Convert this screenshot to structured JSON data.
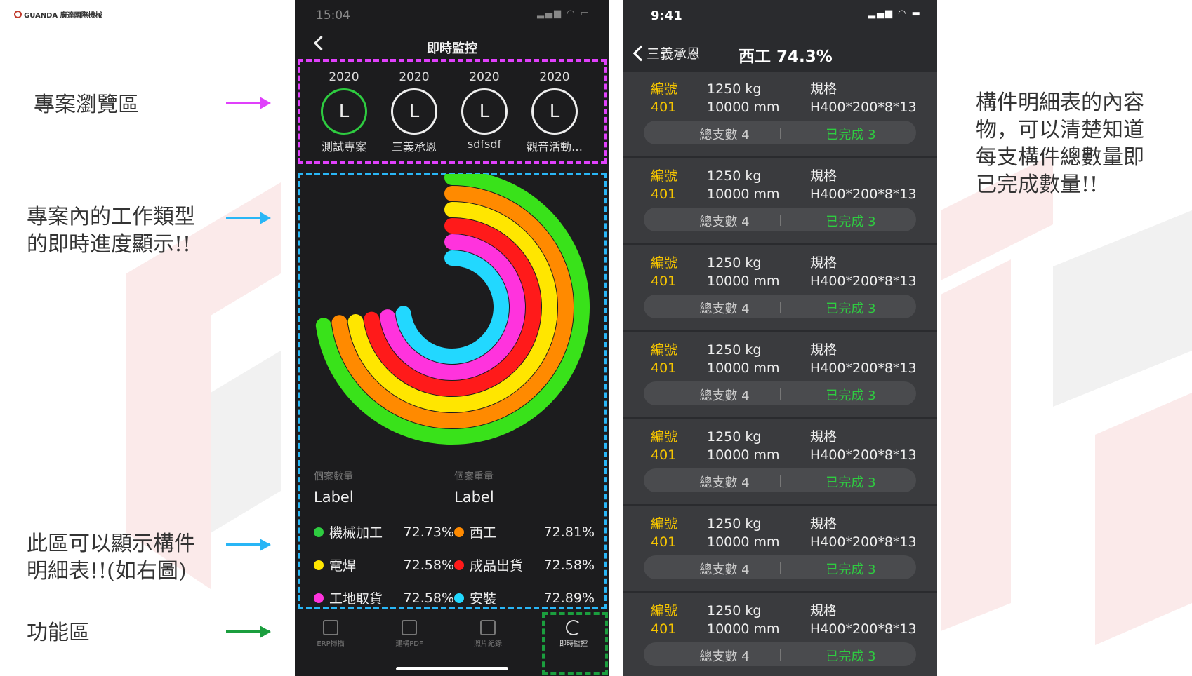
{
  "brand": {
    "logo_text": "GUANDA 廣達國際機械"
  },
  "annotations": [
    {
      "text": "專案瀏覽區",
      "color": "#e040fb"
    },
    {
      "text": "專案內的工作類型\n的即時進度顯示!!",
      "color": "#29b6f6"
    },
    {
      "text": "此區可以顯示構件\n明細表!!(如右圖)",
      "color": "#29b6f6"
    },
    {
      "text": "功能區",
      "color": "#1b9e3e"
    }
  ],
  "right_note": "構件明細表的內容\n物，可以清楚知道\n每支構件總數量即\n已完成數量!!",
  "phone1": {
    "status_time": "15:04",
    "title": "即時監控",
    "projects": [
      {
        "year": "2020",
        "letter": "L",
        "name": "測試專案",
        "ring": "#2ecc40"
      },
      {
        "year": "2020",
        "letter": "L",
        "name": "三義承恩",
        "ring": "#eeeeee"
      },
      {
        "year": "2020",
        "letter": "L",
        "name": "sdfsdf",
        "ring": "#eeeeee"
      },
      {
        "year": "2020",
        "letter": "L",
        "name": "觀音活動…",
        "ring": "#eeeeee"
      }
    ],
    "chart_data": {
      "type": "radial-bar",
      "series": [
        {
          "name": "機械加工",
          "value": 72.73,
          "color": "#39e21a"
        },
        {
          "name": "西工",
          "value": 72.81,
          "color": "#ff8a00"
        },
        {
          "name": "電焊",
          "value": 72.58,
          "color": "#ffe600"
        },
        {
          "name": "成品出貨",
          "value": 72.58,
          "color": "#ff1a1a"
        },
        {
          "name": "工地取貨",
          "value": 72.58,
          "color": "#ff33dd"
        },
        {
          "name": "安裝",
          "value": 72.89,
          "color": "#22d8ff"
        }
      ]
    },
    "stats": {
      "count_label": "個案數量",
      "count_value": "Label",
      "weight_label": "個案重量",
      "weight_value": "Label"
    },
    "legend": [
      {
        "name": "機械加工",
        "pct": "72.73%",
        "color": "#2ecc40"
      },
      {
        "name": "西工",
        "pct": "72.81%",
        "color": "#ff8a00"
      },
      {
        "name": "電焊",
        "pct": "72.58%",
        "color": "#ffe600"
      },
      {
        "name": "成品出貨",
        "pct": "72.58%",
        "color": "#ff1a1a"
      },
      {
        "name": "工地取貨",
        "pct": "72.58%",
        "color": "#ff33dd"
      },
      {
        "name": "安裝",
        "pct": "72.89%",
        "color": "#22d8ff"
      }
    ],
    "tabs": [
      {
        "label": "ERP掃描",
        "icon": "scan-icon"
      },
      {
        "label": "建構PDF",
        "icon": "document-icon"
      },
      {
        "label": "照片紀錄",
        "icon": "camera-icon"
      },
      {
        "label": "即時監控",
        "icon": "monitor-icon"
      }
    ]
  },
  "phone2": {
    "status_time": "9:41",
    "back_label": "三義承恩",
    "title": "西工 74.3%",
    "cards": [
      {
        "id_label": "編號",
        "id": "401",
        "weight": "1250 kg",
        "length": "10000 mm",
        "spec_label": "規格",
        "spec": "H400*200*8*13",
        "total": "總支數 4",
        "done": "已完成 3"
      },
      {
        "id_label": "編號",
        "id": "401",
        "weight": "1250 kg",
        "length": "10000 mm",
        "spec_label": "規格",
        "spec": "H400*200*8*13",
        "total": "總支數 4",
        "done": "已完成 3"
      },
      {
        "id_label": "編號",
        "id": "401",
        "weight": "1250 kg",
        "length": "10000 mm",
        "spec_label": "規格",
        "spec": "H400*200*8*13",
        "total": "總支數 4",
        "done": "已完成 3"
      },
      {
        "id_label": "編號",
        "id": "401",
        "weight": "1250 kg",
        "length": "10000 mm",
        "spec_label": "規格",
        "spec": "H400*200*8*13",
        "total": "總支數 4",
        "done": "已完成 3"
      },
      {
        "id_label": "編號",
        "id": "401",
        "weight": "1250 kg",
        "length": "10000 mm",
        "spec_label": "規格",
        "spec": "H400*200*8*13",
        "total": "總支數 4",
        "done": "已完成 3"
      },
      {
        "id_label": "編號",
        "id": "401",
        "weight": "1250 kg",
        "length": "10000 mm",
        "spec_label": "規格",
        "spec": "H400*200*8*13",
        "total": "總支數 4",
        "done": "已完成 3"
      },
      {
        "id_label": "編號",
        "id": "401",
        "weight": "1250 kg",
        "length": "10000 mm",
        "spec_label": "規格",
        "spec": "H400*200*8*13",
        "total": "總支數 4",
        "done": "已完成 3"
      }
    ]
  }
}
